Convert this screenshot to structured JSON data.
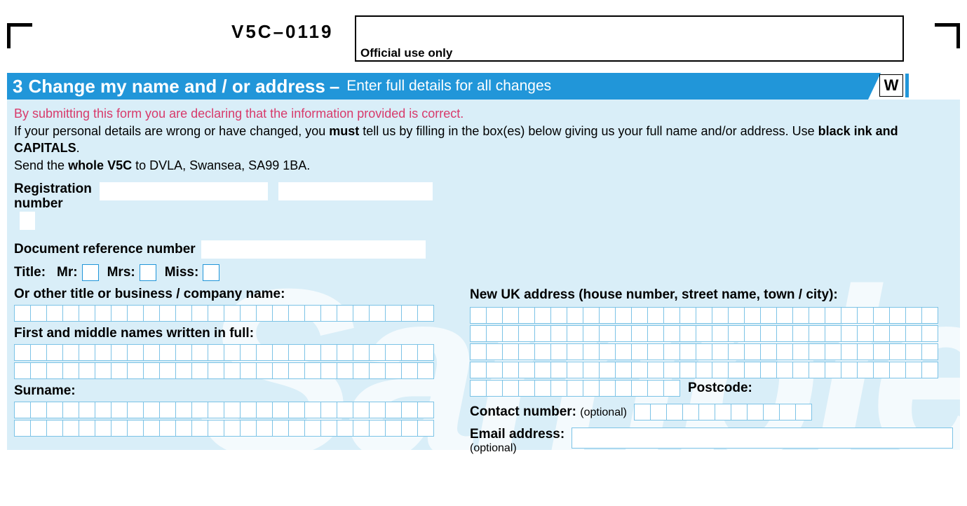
{
  "form_code": "V5C–0119",
  "official_use_label": "Official use only",
  "section": {
    "number": "3",
    "title": "Change my name and / or address",
    "dash": "–",
    "subtitle": "Enter full details for all changes",
    "w_marker": "W"
  },
  "declaration": "By submitting this form you are declaring that the information provided is correct.",
  "instructions": {
    "line1_a": "If your personal details are wrong or have changed, you ",
    "line1_must": "must",
    "line1_b": " tell us by filling in the box(es) below giving us your full name and/or address. Use ",
    "line1_bold2": "black ink and CAPITALS",
    "line1_c": ".",
    "line2_a": "Send the ",
    "line2_bold": "whole V5C",
    "line2_b": " to DVLA, Swansea, SA99 1BA."
  },
  "left": {
    "registration_label": "Registration number",
    "doc_ref_label": "Document reference number",
    "title_label": "Title:",
    "title_mr": "Mr:",
    "title_mrs": "Mrs:",
    "title_miss": "Miss:",
    "other_title_label": "Or other title or business / company name:",
    "first_names_label": "First and middle names written in full:",
    "surname_label": "Surname:"
  },
  "right": {
    "address_label": "New UK address (house number, street name, town / city):",
    "postcode_label": "Postcode:",
    "contact_label": "Contact number:",
    "contact_optional": "(optional)",
    "email_label": "Email address:",
    "email_optional": "(optional)"
  },
  "watermark": "Sample"
}
